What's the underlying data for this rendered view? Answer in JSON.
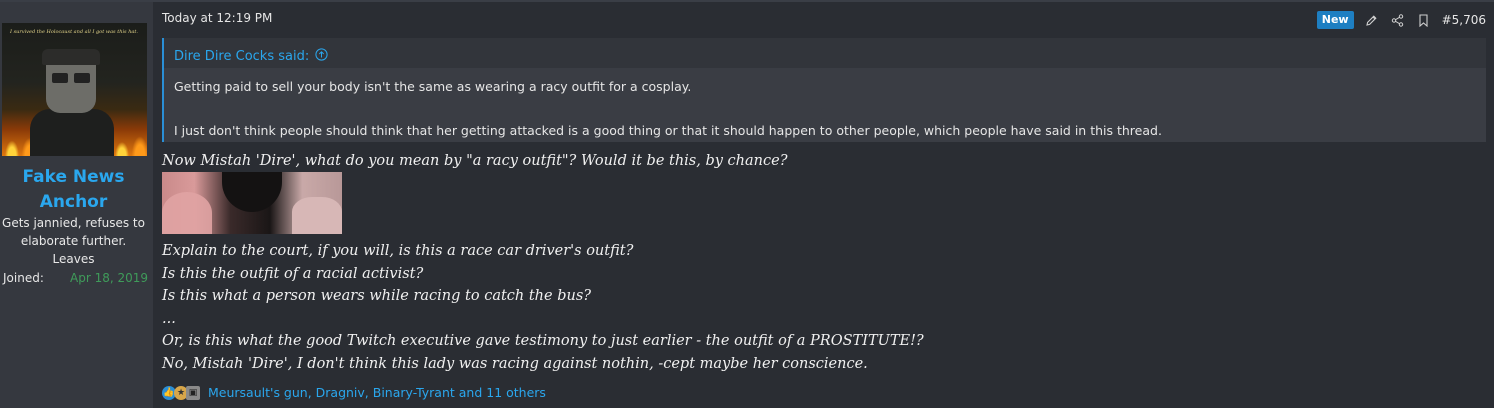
{
  "user": {
    "avatar_caption": "I survived the Holocaust and all I got was this hat.",
    "name_line1": "Fake News",
    "name_line2": "Anchor",
    "title_lines": [
      "Gets jannied, refuses to",
      "elaborate further.",
      "Leaves"
    ],
    "joined_label": "Joined:",
    "joined_date": "Apr 18, 2019"
  },
  "post": {
    "timestamp": "Today at 12:19 PM",
    "badge": "New",
    "number": "#5,706",
    "icons": [
      "edit-icon",
      "share-icon",
      "bookmark-icon"
    ]
  },
  "quote": {
    "author": "Dire Dire Cocks said:",
    "line1": "Getting paid to sell your body isn't the same as wearing a racy outfit for a cosplay.",
    "line2": "I just don't think people should think that her getting attacked is a good thing or that it should happen to other people, which people have said in this thread."
  },
  "message": {
    "intro": "Now Mistah 'Dire', what do you mean by \"a racy outfit\"? Would it be this, by chance?",
    "lines": [
      "Explain to the court, if you will, is this a race car driver's outfit?",
      "Is this the outfit of a racial activist?",
      "Is this what a person wears while racing to catch the bus?",
      "...",
      "Or, is this what the good Twitch executive gave testimony to just earlier - the outfit of a PROSTITUTE!?",
      "No, Mistah 'Dire', I don't think this lady was racing against nothin, -cept maybe her conscience."
    ]
  },
  "reactions": {
    "text": "Meursault's gun, Dragniv, Binary-Tyrant and 11 others"
  },
  "colors": {
    "background": "#2a2d33",
    "panel": "#35383f",
    "link": "#2aa7ee",
    "joined": "#3f9b5a",
    "badge": "#1e7fc2"
  }
}
